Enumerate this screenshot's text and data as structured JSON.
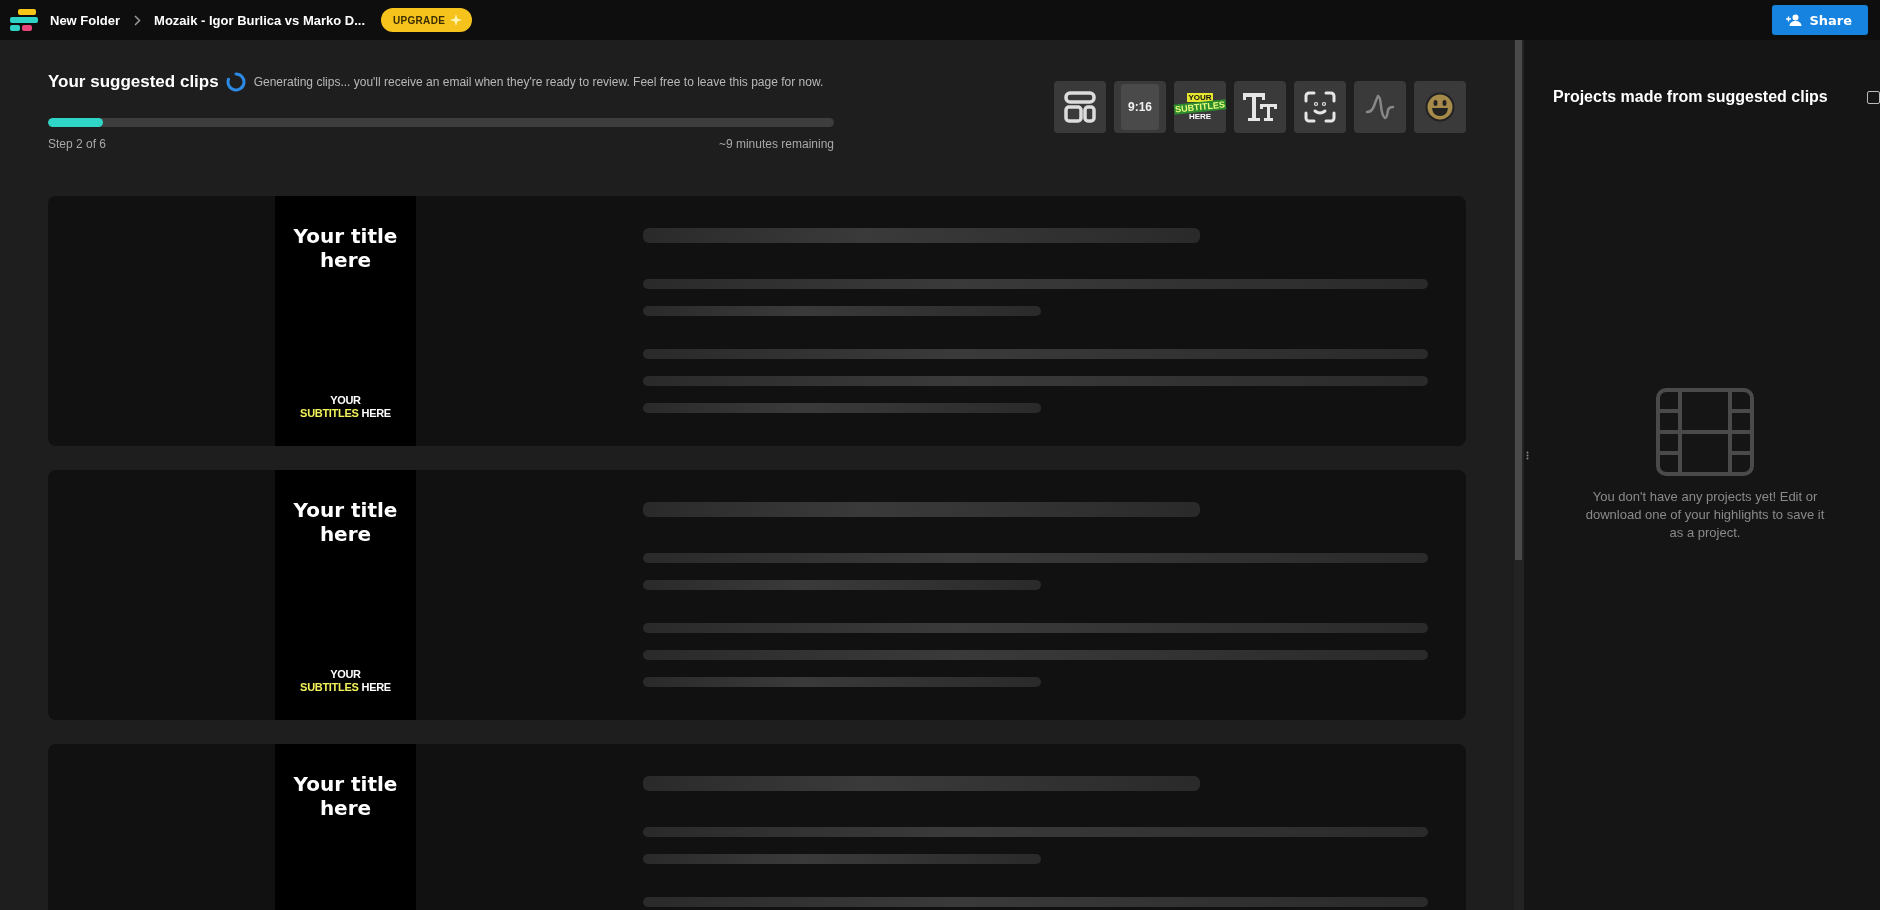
{
  "topbar": {
    "breadcrumb": [
      "New Folder",
      "Mozaik - Igor Burlica vs Marko D..."
    ],
    "upgrade": "UPGRADE",
    "share": "Share"
  },
  "header": {
    "title": "Your suggested clips",
    "status": "Generating clips... you'll receive an email when they're ready to review. Feel free to leave this page for now.",
    "progress": {
      "level": 0.07,
      "step": "Step 2 of 6",
      "remaining": "~9 minutes remaining"
    }
  },
  "toolbar": [
    {
      "kind": "layout"
    },
    {
      "kind": "ratio",
      "label": "9:16"
    },
    {
      "kind": "subtitles",
      "label": [
        "YOUR",
        "SUBTITLES",
        "HERE"
      ]
    },
    {
      "kind": "text"
    },
    {
      "kind": "face"
    },
    {
      "kind": "wave"
    },
    {
      "kind": "emoji"
    }
  ],
  "clips": [
    {
      "title": "Your title here",
      "subtitle": [
        [
          {
            "text": "YOUR",
            "highlight": false
          }
        ],
        [
          {
            "text": "SUBTITLES",
            "highlight": true
          },
          {
            "text": "HERE",
            "highlight": false
          }
        ]
      ],
      "loading": true,
      "skeleton": [
        {
          "kind": "heading"
        },
        {
          "kind": "full"
        },
        {
          "kind": "short"
        },
        {
          "kind": "full"
        },
        {
          "kind": "full"
        },
        {
          "kind": "short"
        }
      ]
    },
    {
      "title": "Your title here",
      "subtitle": [
        [
          {
            "text": "YOUR",
            "highlight": false
          }
        ],
        [
          {
            "text": "SUBTITLES",
            "highlight": true
          },
          {
            "text": "HERE",
            "highlight": false
          }
        ]
      ],
      "loading": true,
      "skeleton": [
        {
          "kind": "heading"
        },
        {
          "kind": "full"
        },
        {
          "kind": "short"
        },
        {
          "kind": "full"
        },
        {
          "kind": "full"
        },
        {
          "kind": "short"
        }
      ]
    },
    {
      "title": "Your title here",
      "loading": true,
      "skeleton": [
        {
          "kind": "heading"
        },
        {
          "kind": "full"
        },
        {
          "kind": "short"
        },
        {
          "kind": "full"
        }
      ]
    }
  ],
  "projects": {
    "title": "Projects made from suggested clips",
    "checked": false,
    "empty": "You don't have any projects yet! Edit or download one of your highlights to save it as a project."
  }
}
